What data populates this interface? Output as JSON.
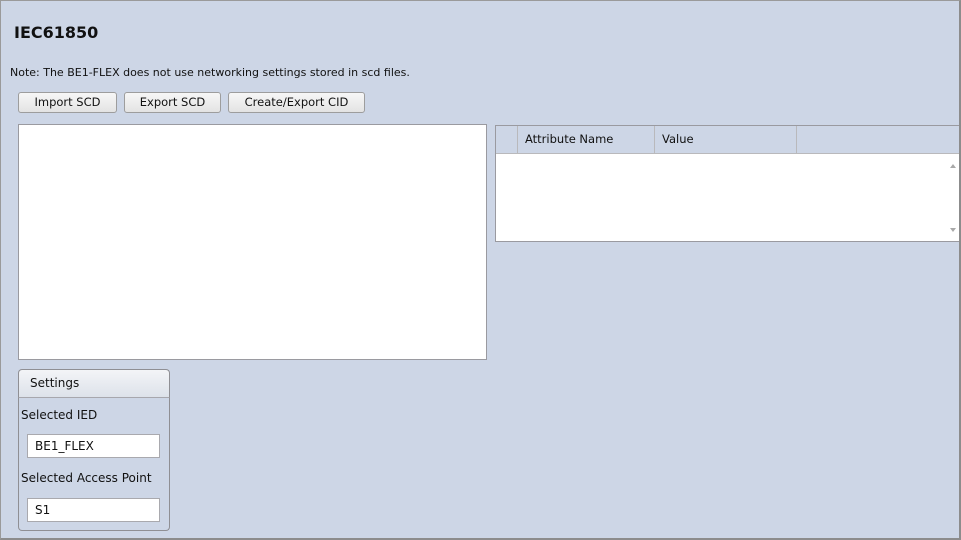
{
  "page": {
    "title": "IEC61850",
    "note": "Note: The BE1-FLEX does not use networking settings stored in scd files."
  },
  "toolbar": {
    "import_label": "Import SCD",
    "export_label": "Export SCD",
    "create_export_label": "Create/Export CID"
  },
  "attribute_grid": {
    "columns": [
      "",
      "Attribute Name",
      "Value",
      ""
    ],
    "rows": []
  },
  "settings": {
    "tab_label": "Settings",
    "selected_ied_label": "Selected IED",
    "selected_ied_value": "BE1_FLEX",
    "selected_access_point_label": "Selected Access Point",
    "selected_access_point_value": "S1"
  },
  "colors": {
    "background": "#cdd6e6",
    "panel": "#ffffff",
    "border": "#9a9aa0"
  },
  "icons": [
    "scroll-up-arrow-icon",
    "scroll-down-arrow-icon"
  ]
}
